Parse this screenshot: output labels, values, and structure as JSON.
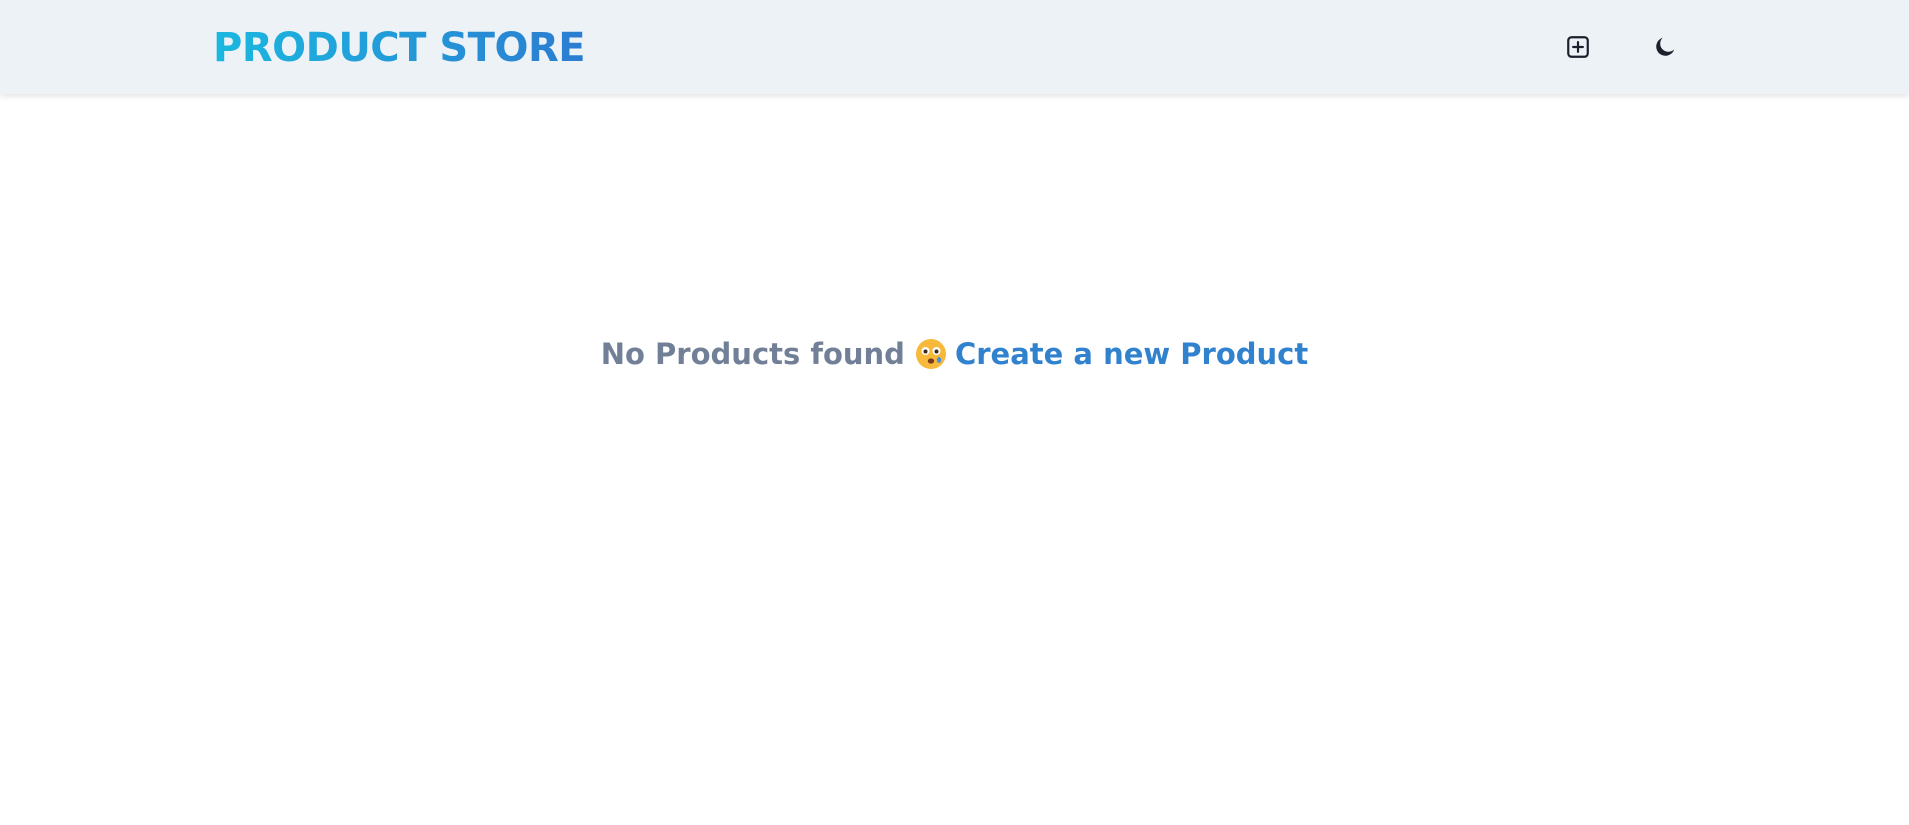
{
  "navbar": {
    "brand": "PRODUCT STORE",
    "add_icon": "plus-square-icon",
    "theme_icon": "moon-icon"
  },
  "main": {
    "empty_message": "No Products found",
    "empty_emoji": "sad-face-emoji",
    "create_link": "Create a new Product"
  },
  "colors": {
    "navbar_bg": "#edf2f7",
    "brand_gradient_start": "#1ab8e0",
    "brand_gradient_end": "#2c7cd0",
    "empty_text": "#718096",
    "link": "#3182ce"
  }
}
